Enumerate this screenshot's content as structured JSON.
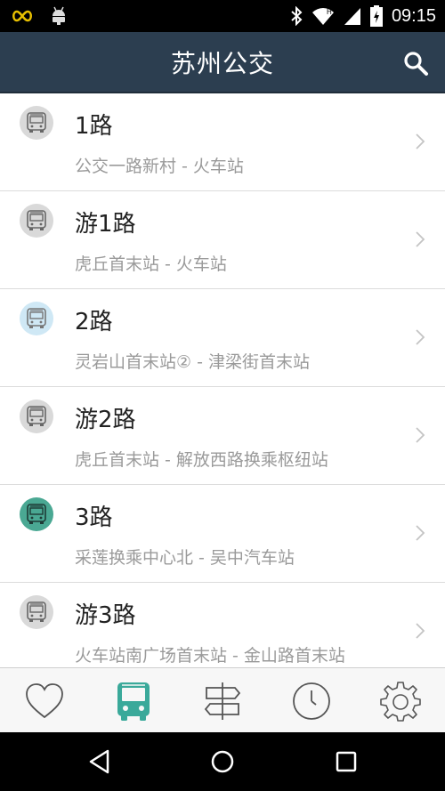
{
  "status_bar": {
    "time": "09:15",
    "icons": [
      "infinity-icon",
      "android-icon",
      "bluetooth-icon",
      "wifi-icon",
      "signal-icon",
      "battery-icon"
    ]
  },
  "header": {
    "title": "苏州公交",
    "search_icon": "search-icon"
  },
  "routes": [
    {
      "name": "1路",
      "route": "公交一路新村 - 火车站",
      "icon_style": "grey"
    },
    {
      "name": "游1路",
      "route": "虎丘首末站 - 火车站",
      "icon_style": "grey"
    },
    {
      "name": "2路",
      "route": "灵岩山首末站② - 津梁街首末站",
      "icon_style": "lightblue"
    },
    {
      "name": "游2路",
      "route": "虎丘首末站 - 解放西路换乘枢纽站",
      "icon_style": "grey"
    },
    {
      "name": "3路",
      "route": "采莲换乘中心北 - 吴中汽车站",
      "icon_style": "teal"
    },
    {
      "name": "游3路",
      "route": "火车站南广场首末站 - 金山路首末站",
      "icon_style": "grey"
    }
  ],
  "tabs": [
    {
      "icon": "heart-icon",
      "active": false
    },
    {
      "icon": "bus-icon",
      "active": true
    },
    {
      "icon": "signpost-icon",
      "active": false
    },
    {
      "icon": "clock-icon",
      "active": false
    },
    {
      "icon": "gear-icon",
      "active": false
    }
  ],
  "colors": {
    "header_bg": "#2c3e50",
    "accent": "#3aa99a",
    "icon_grey_bg": "#d9d9d9",
    "icon_lightblue_bg": "#cfe8f5",
    "icon_teal_bg": "#4aa893"
  }
}
